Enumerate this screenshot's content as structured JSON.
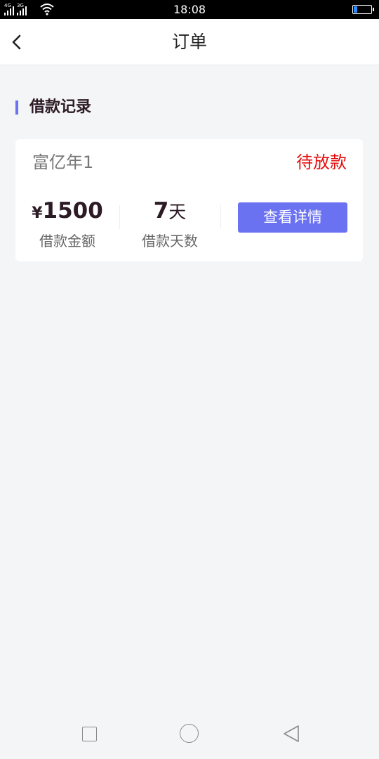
{
  "status_bar": {
    "network_1": "4G",
    "network_2": "3G",
    "time": "18:08",
    "icons": [
      "signal-icon",
      "wifi-icon",
      "battery-icon"
    ]
  },
  "header": {
    "title": "订单",
    "back_icon": "chevron-left-icon"
  },
  "section": {
    "title": "借款记录"
  },
  "loan_card": {
    "product_name": "富亿年1",
    "status": "待放款",
    "currency_symbol": "¥",
    "amount": "1500",
    "amount_label": "借款金额",
    "days": "7",
    "days_unit": "天",
    "days_label": "借款天数",
    "detail_button": "查看详情"
  },
  "nav_bar": {
    "icons": [
      "recent-apps-icon",
      "home-icon",
      "back-triangle-icon"
    ]
  },
  "colors": {
    "accent": "#6b72f2",
    "status_red": "#e40c0c",
    "page_bg": "#f4f5f7",
    "dark_text": "#2c1a24"
  }
}
